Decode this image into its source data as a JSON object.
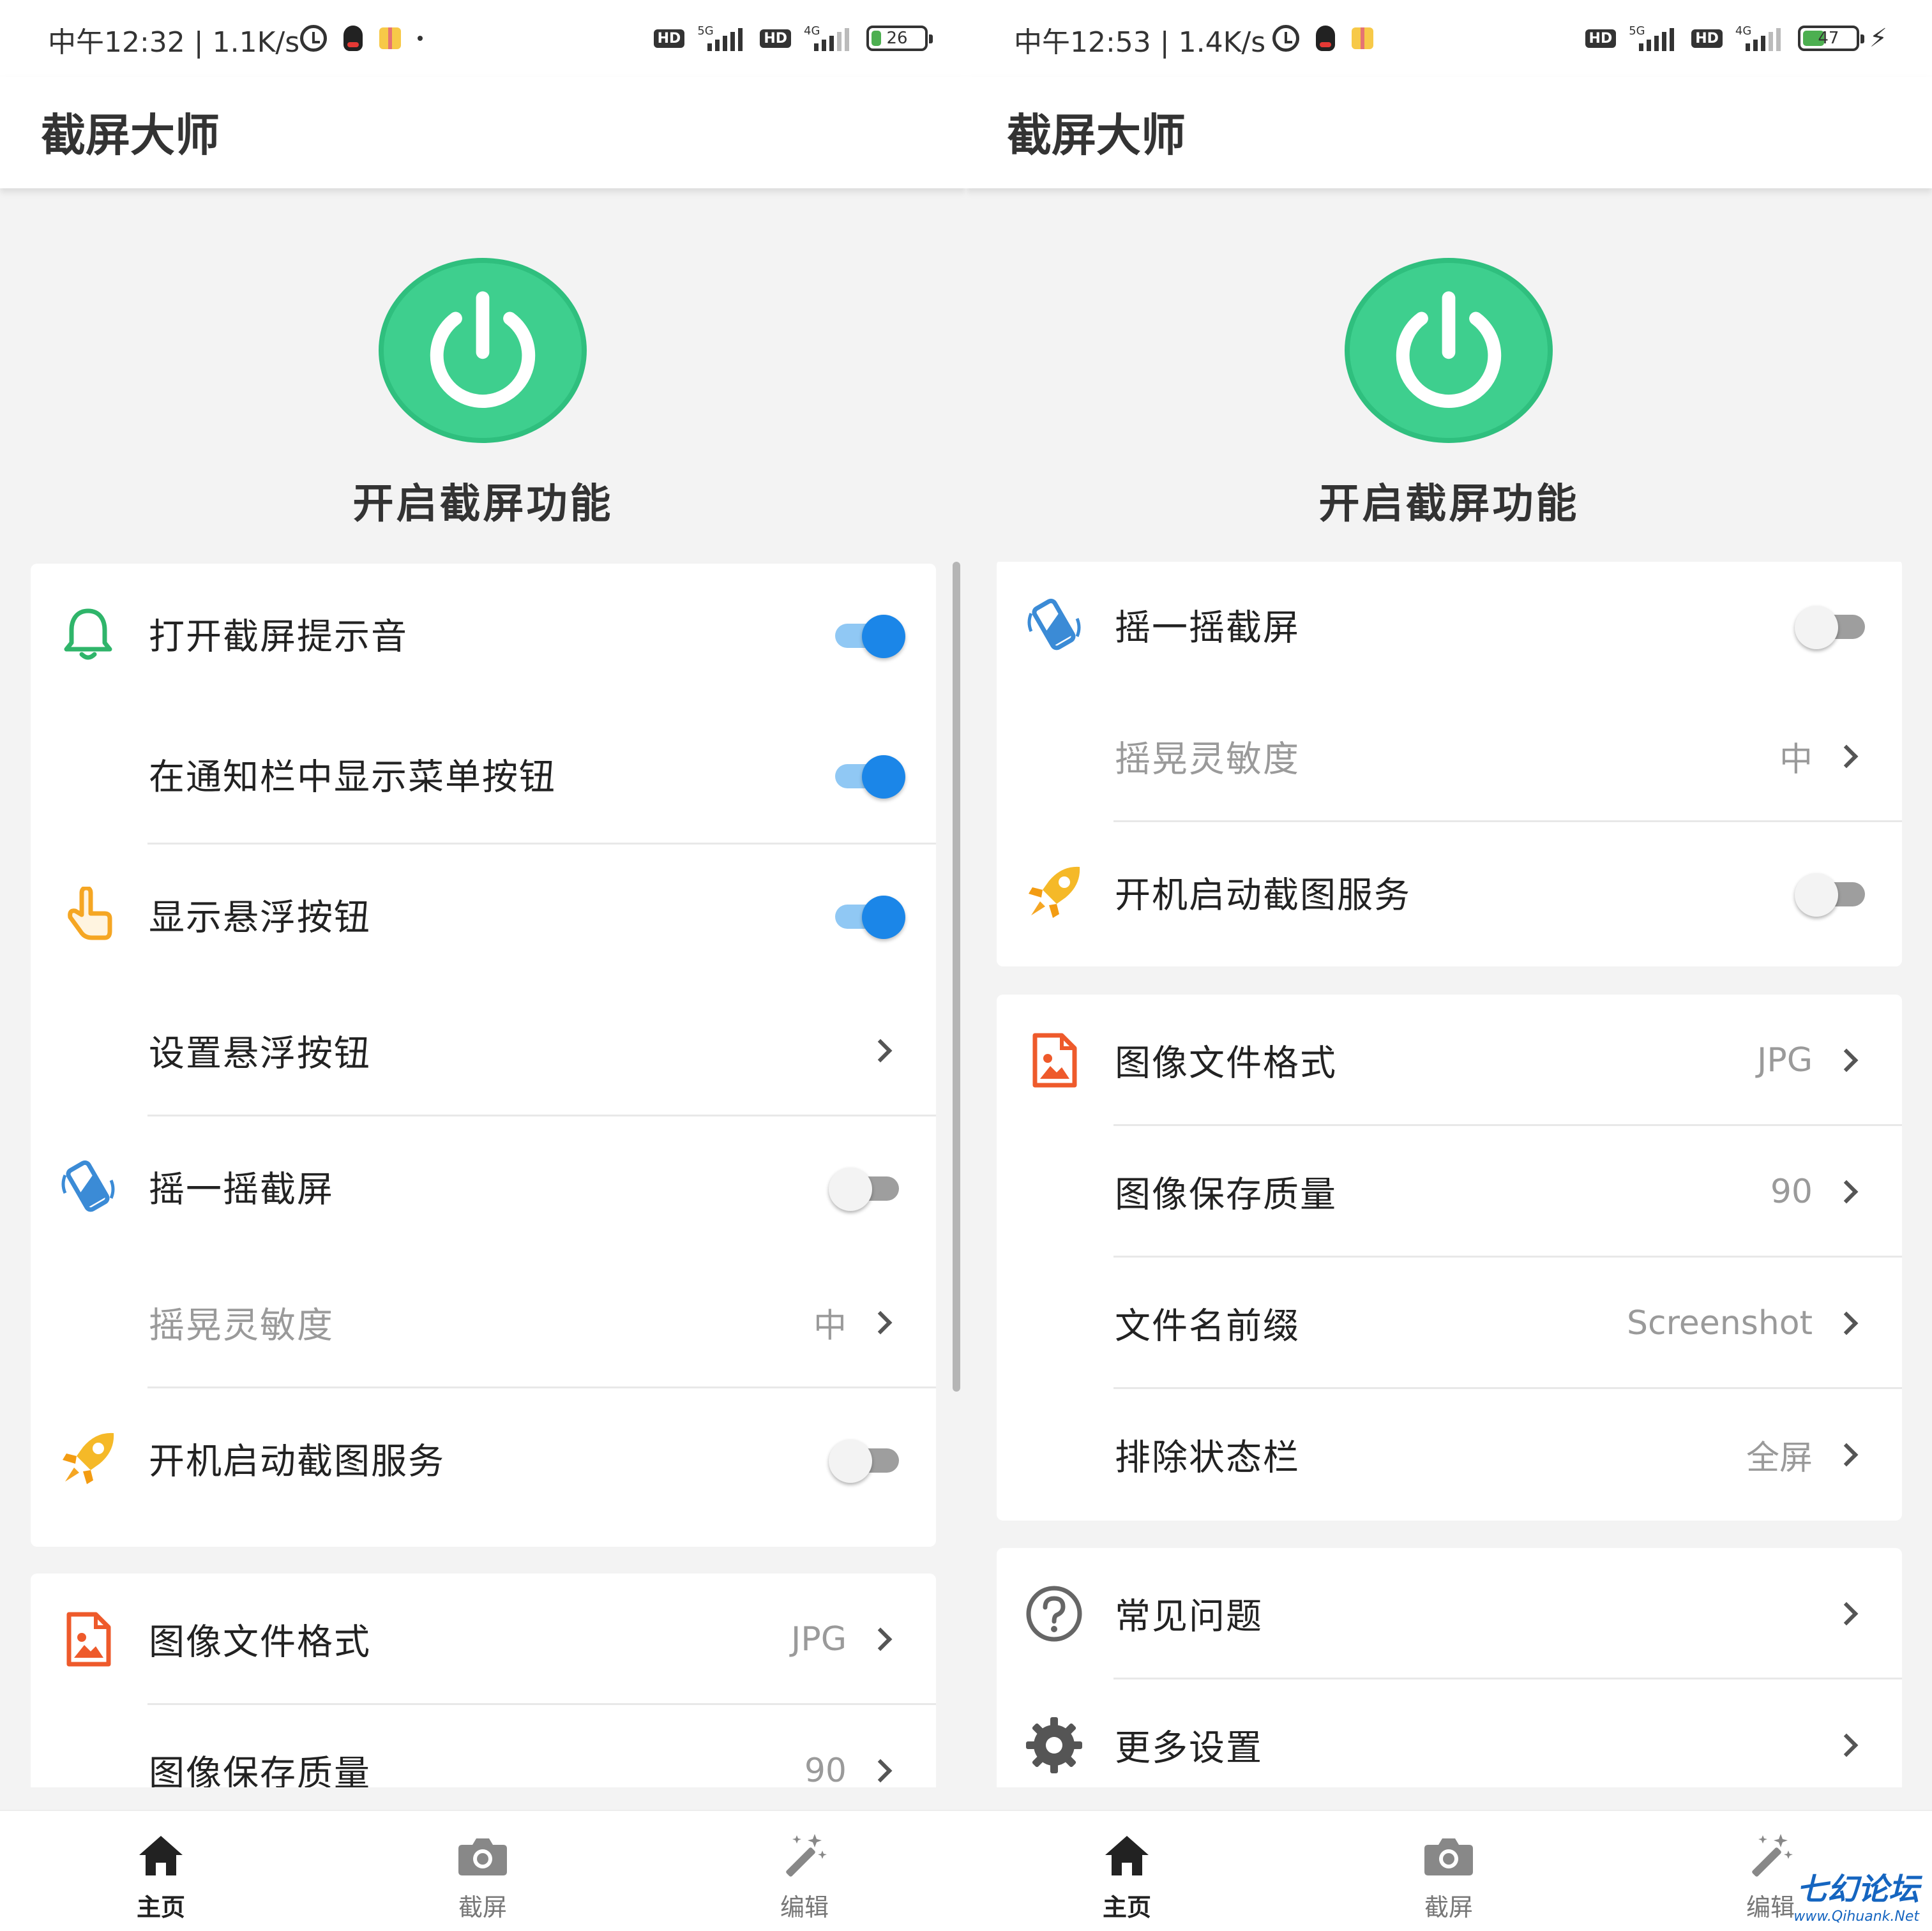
{
  "colors": {
    "accent_green": "#3ecf8e",
    "toggle_on": "#1b86e8",
    "bell_green": "#2fb56a",
    "orange": "#f5a623",
    "blue_phone": "#3b8bd6",
    "doc_red": "#ee5a2b"
  },
  "left": {
    "status": {
      "time": "中午12:32 | 1.1K/s",
      "net1": "5G",
      "net2": "4G",
      "hd": "HD",
      "battery": "26",
      "battery_level": 0.26
    },
    "app_title": "截屏大师",
    "power_label": "开启截屏功能",
    "card1": {
      "sound": {
        "label": "打开截屏提示音",
        "icon": "bell-icon",
        "on": true
      },
      "notif_menu": {
        "label": "在通知栏中显示菜单按钮",
        "on": true
      },
      "float_show": {
        "label": "显示悬浮按钮",
        "icon": "pointing-hand-icon",
        "on": true
      },
      "float_set": {
        "label": "设置悬浮按钮"
      },
      "shake": {
        "label": "摇一摇截屏",
        "icon": "shake-phone-icon",
        "on": false
      },
      "sensitivity": {
        "label": "摇晃灵敏度",
        "value": "中"
      },
      "boot": {
        "label": "开机启动截图服务",
        "icon": "rocket-icon",
        "on": false
      }
    },
    "card2": {
      "format": {
        "label": "图像文件格式",
        "value": "JPG",
        "icon": "image-file-icon"
      },
      "quality": {
        "label": "图像保存质量",
        "value": "90"
      }
    }
  },
  "right": {
    "status": {
      "time": "中午12:53 | 1.4K/s",
      "net1": "5G",
      "net2": "4G",
      "hd": "HD",
      "battery": "47",
      "battery_level": 0.47
    },
    "app_title": "截屏大师",
    "power_label": "开启截屏功能",
    "card1": {
      "shake": {
        "label": "摇一摇截屏",
        "icon": "shake-phone-icon",
        "on": false
      },
      "sensitivity": {
        "label": "摇晃灵敏度",
        "value": "中"
      },
      "boot": {
        "label": "开机启动截图服务",
        "icon": "rocket-icon",
        "on": false
      }
    },
    "card2": {
      "format": {
        "label": "图像文件格式",
        "value": "JPG",
        "icon": "image-file-icon"
      },
      "quality": {
        "label": "图像保存质量",
        "value": "90"
      },
      "prefix": {
        "label": "文件名前缀",
        "value": "Screenshot"
      },
      "exclude_status": {
        "label": "排除状态栏",
        "value": "全屏"
      }
    },
    "card3": {
      "faq": {
        "label": "常见问题",
        "icon": "question-circle-icon"
      },
      "more": {
        "label": "更多设置",
        "icon": "gear-icon"
      }
    }
  },
  "nav": {
    "home": "主页",
    "capture": "截屏",
    "edit": "编辑"
  },
  "watermark": {
    "line1": "七幻论坛",
    "line2": "www.Qihuank.Net"
  }
}
